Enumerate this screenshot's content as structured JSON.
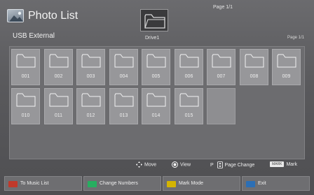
{
  "header": {
    "title": "Photo List",
    "page_indicator": "Page 1/1",
    "source": "USB External",
    "drive": "Drive1",
    "page_small": "Page 1/1"
  },
  "folders": [
    "001",
    "002",
    "003",
    "004",
    "005",
    "006",
    "007",
    "008",
    "009",
    "010",
    "011",
    "012",
    "013",
    "014",
    "015"
  ],
  "hints": {
    "move": "Move",
    "view": "View",
    "page_key": "P",
    "page_change": "Page Change",
    "mark_key": "MARK",
    "mark": "Mark"
  },
  "buttons": [
    {
      "label": "To Music List",
      "color": "#c0392b"
    },
    {
      "label": "Change Numbers",
      "color": "#27ae60"
    },
    {
      "label": "Mark Mode",
      "color": "#d4b400"
    },
    {
      "label": "Exit",
      "color": "#2c6fb5"
    }
  ],
  "icons": {
    "app": "photo-icon",
    "drive": "folder-icon",
    "move": "arrows-icon",
    "view": "ok-icon",
    "page": "updown-icon"
  }
}
